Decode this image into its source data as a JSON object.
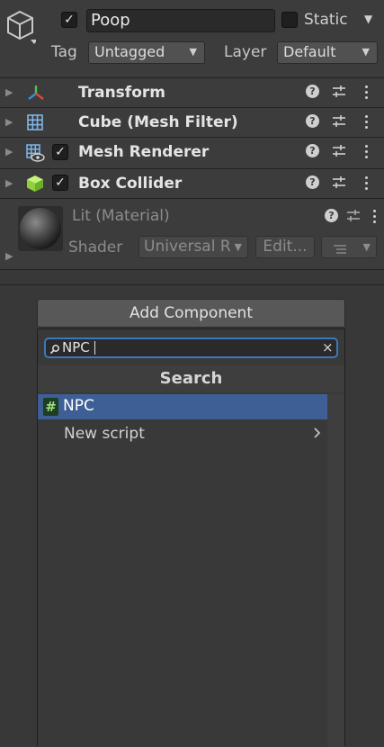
{
  "header": {
    "object_name": "Poop",
    "static_label": "Static",
    "tag_label": "Tag",
    "tag_value": "Untagged",
    "layer_label": "Layer",
    "layer_value": "Default",
    "active_checked": true,
    "static_checked": false
  },
  "components": [
    {
      "name": "Transform",
      "icon": "transform-axes-icon",
      "has_checkbox": false
    },
    {
      "name": "Cube (Mesh Filter)",
      "icon": "mesh-filter-grid-icon",
      "has_checkbox": false
    },
    {
      "name": "Mesh Renderer",
      "icon": "mesh-renderer-icon",
      "has_checkbox": true,
      "checked": true
    },
    {
      "name": "Box Collider",
      "icon": "box-collider-cube-icon",
      "has_checkbox": true,
      "checked": true
    }
  ],
  "material": {
    "name": "Lit (Material)",
    "shader_label": "Shader",
    "shader_value": "Universal R",
    "edit_label": "Edit..."
  },
  "add_component": {
    "button_label": "Add Component",
    "search_value": "NPC",
    "search_header": "Search",
    "results": [
      {
        "label": "NPC",
        "icon": "script-hash-icon",
        "selected": true
      },
      {
        "label": "New script",
        "icon": "chevron-right-icon",
        "selected": false
      }
    ]
  },
  "colors": {
    "selection": "#3e5f96",
    "focus_border": "#3a79bb",
    "panel_bg": "#383838"
  }
}
